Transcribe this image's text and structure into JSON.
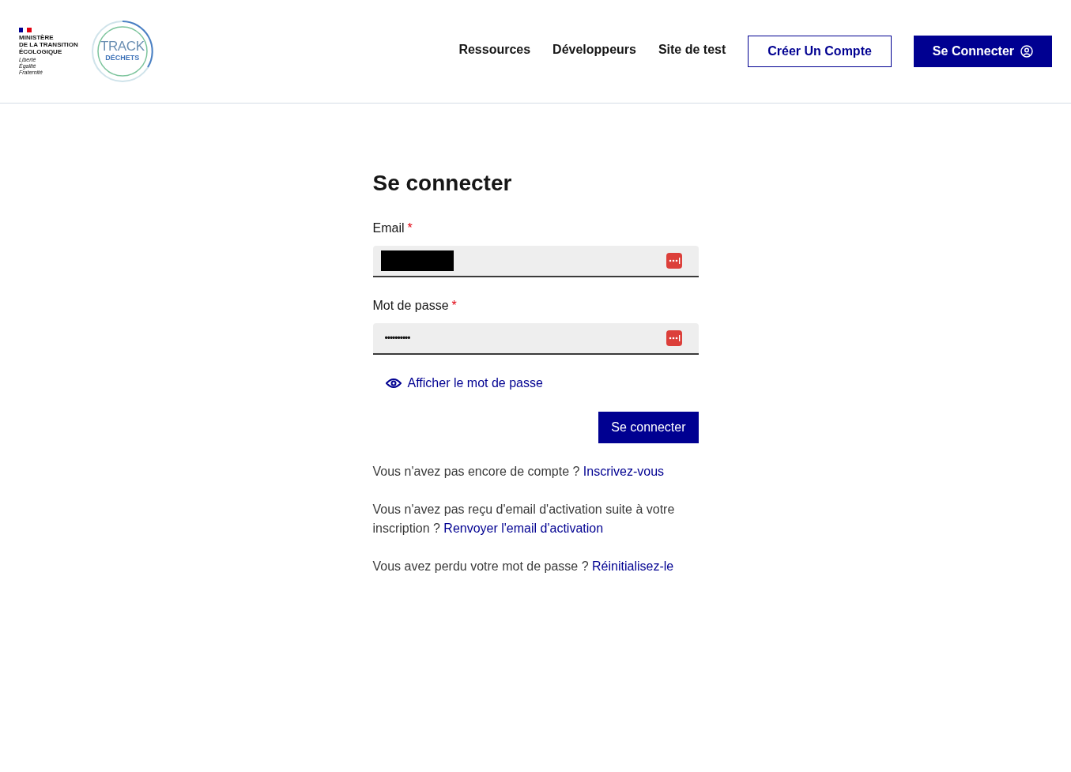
{
  "header": {
    "ministry": [
      "MINISTÈRE",
      "DE LA TRANSITION",
      "ÉCOLOGIQUE"
    ],
    "motto": [
      "Liberté",
      "Égalité",
      "Fraternité"
    ],
    "logo": {
      "top": "TRACK",
      "bottom": "DÉCHETS"
    },
    "nav": [
      "Ressources",
      "Développeurs",
      "Site de test"
    ],
    "buttons": [
      {
        "label": "Créer Un Compte",
        "kind": "outline"
      },
      {
        "label": "Se Connecter",
        "kind": "primary"
      }
    ]
  },
  "form": {
    "title": "Se connecter",
    "fields": [
      {
        "label": "Email",
        "required": "*",
        "kind": "redacted"
      },
      {
        "label": "Mot de passe",
        "required": "*",
        "kind": "password",
        "value": "••••••••••"
      }
    ],
    "show_password": "Afficher le mot de passe",
    "submit": "Se connecter",
    "paragraphs": [
      {
        "text": "Vous n'avez pas encore de compte ?",
        "link": "Inscrivez-vous"
      },
      {
        "text": "Vous n'avez pas reçu d'email d'activation suite à votre inscription ?",
        "link": "Renvoyer l'email d'activation"
      },
      {
        "text": "Vous avez perdu votre mot de passe ?",
        "link": "Réinitialisez-le"
      }
    ]
  }
}
